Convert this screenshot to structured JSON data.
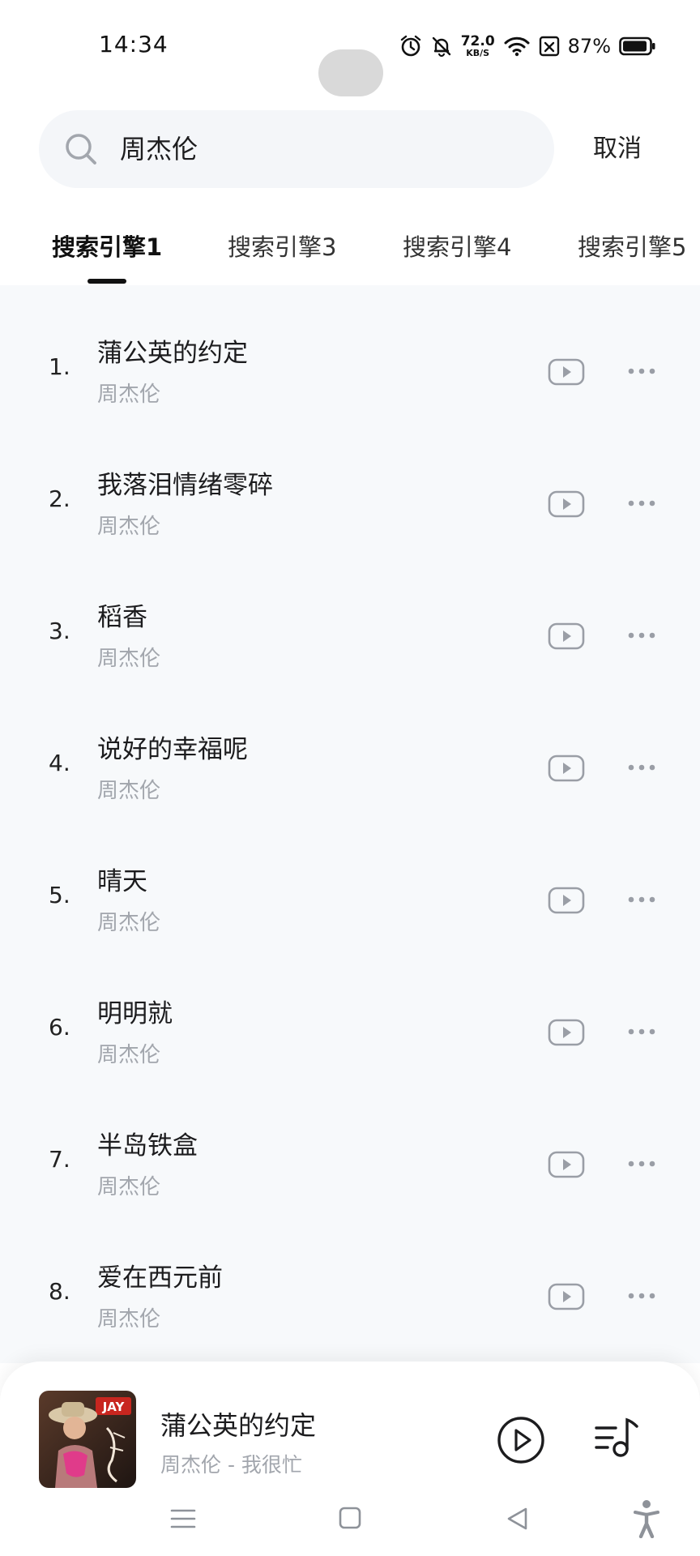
{
  "status_bar": {
    "time": "14:34",
    "net_speed_value": "72.0",
    "net_speed_unit": "KB/S",
    "battery": "87%"
  },
  "search": {
    "query": "周杰伦",
    "cancel_label": "取消"
  },
  "tabs": [
    {
      "label": "搜索引擎1",
      "active": true
    },
    {
      "label": "搜索引擎3",
      "active": false
    },
    {
      "label": "搜索引擎4",
      "active": false
    },
    {
      "label": "搜索引擎5",
      "active": false
    }
  ],
  "songs": [
    {
      "index": "1.",
      "title": "蒲公英的约定",
      "artist": "周杰伦"
    },
    {
      "index": "2.",
      "title": "我落泪情绪零碎",
      "artist": "周杰伦"
    },
    {
      "index": "3.",
      "title": "稻香",
      "artist": "周杰伦"
    },
    {
      "index": "4.",
      "title": "说好的幸福呢",
      "artist": "周杰伦"
    },
    {
      "index": "5.",
      "title": "晴天",
      "artist": "周杰伦"
    },
    {
      "index": "6.",
      "title": "明明就",
      "artist": "周杰伦"
    },
    {
      "index": "7.",
      "title": "半岛铁盒",
      "artist": "周杰伦"
    },
    {
      "index": "8.",
      "title": "爱在西元前",
      "artist": "周杰伦"
    }
  ],
  "now_playing": {
    "title": "蒲公英的约定",
    "subtitle": "周杰伦 - 我很忙",
    "album_art_text": "JAY"
  },
  "icons": {
    "video": "video-play-icon",
    "more": "more-dots-icon",
    "play": "play-circle-icon",
    "playlist": "playlist-music-icon"
  },
  "colors": {
    "list_background": "#f7f9fb",
    "search_background": "#f4f6f9",
    "secondary_text": "#a2a6ad",
    "icon_gray": "#9a9ea6"
  }
}
